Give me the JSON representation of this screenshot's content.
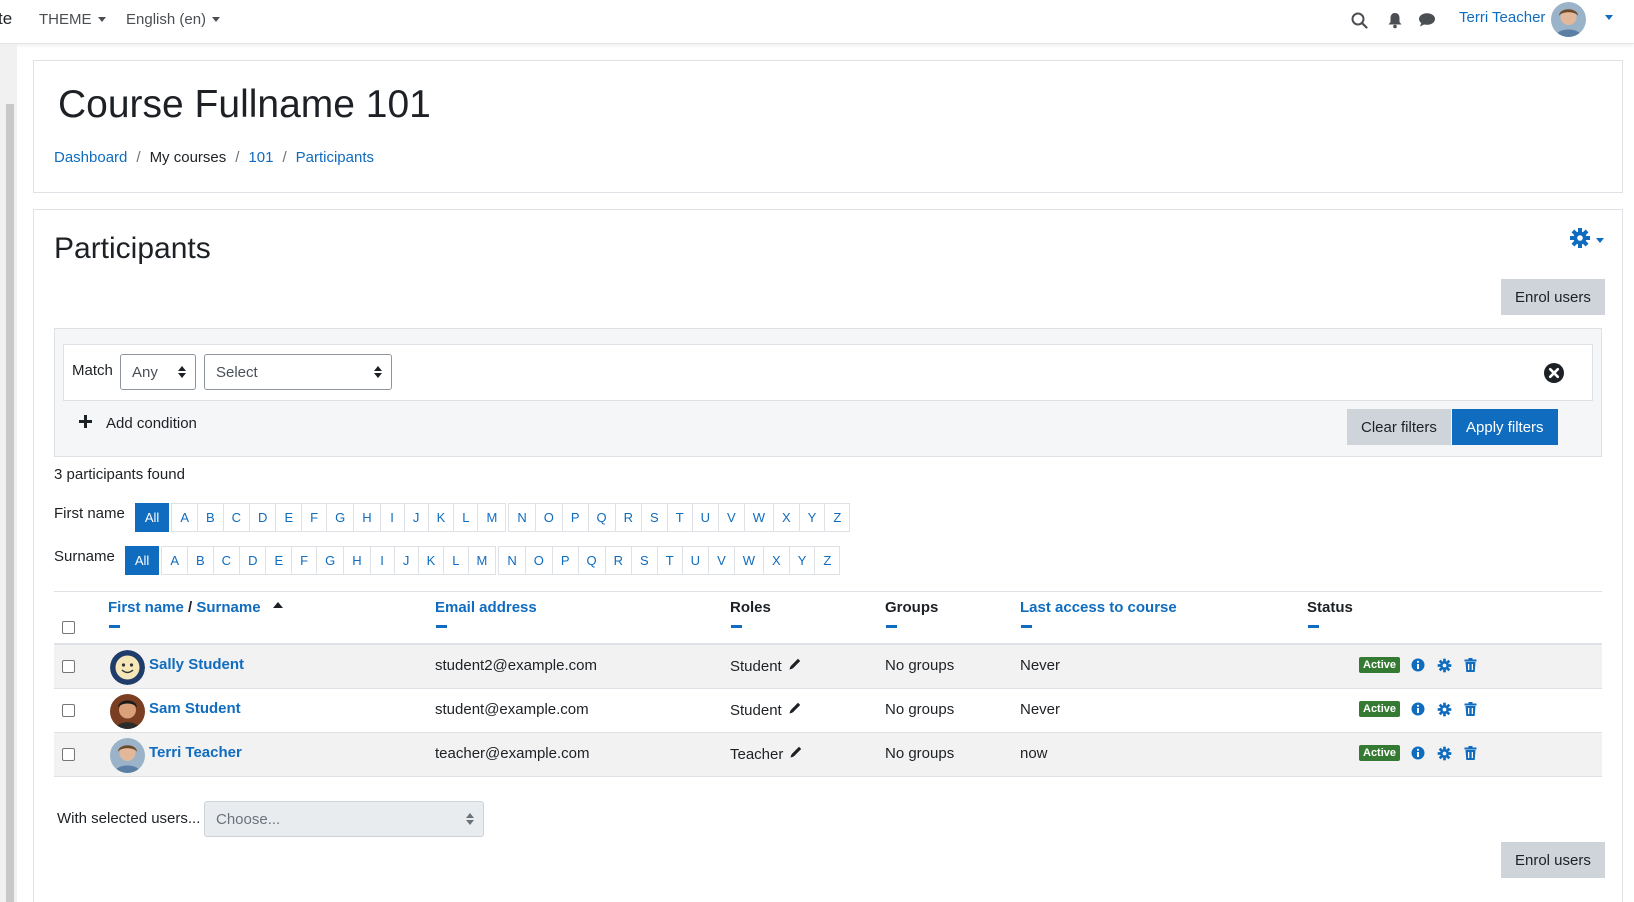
{
  "navbar": {
    "brand_fragment": "te",
    "theme_label": "THEME",
    "language_label": "English (en)",
    "user_name": "Terri Teacher"
  },
  "header": {
    "title": "Course Fullname 101",
    "breadcrumb": [
      "Dashboard",
      "My courses",
      "101",
      "Participants"
    ]
  },
  "participants": {
    "title": "Participants",
    "enrol_label": "Enrol users",
    "filter": {
      "match_label": "Match",
      "match_value": "Any",
      "select_value": "Select",
      "add_condition": "Add condition",
      "clear_label": "Clear filters",
      "apply_label": "Apply filters"
    },
    "found_text": "3 participants found",
    "firstname_label": "First name",
    "surname_label": "Surname",
    "initials_all": "All",
    "initials_1": [
      "A",
      "B",
      "C",
      "D",
      "E",
      "F",
      "G",
      "H",
      "I",
      "J",
      "K",
      "L",
      "M"
    ],
    "initials_2": [
      "N",
      "O",
      "P",
      "Q",
      "R",
      "S",
      "T",
      "U",
      "V",
      "W",
      "X",
      "Y",
      "Z"
    ],
    "columns": {
      "firstname": "First name",
      "slash": "/",
      "surname": "Surname",
      "email": "Email address",
      "roles": "Roles",
      "groups": "Groups",
      "lastaccess": "Last access to course",
      "status": "Status"
    },
    "rows": [
      {
        "name": "Sally Student",
        "email": "student2@example.com",
        "role": "Student",
        "groups": "No groups",
        "last_access": "Never",
        "status": "Active"
      },
      {
        "name": "Sam Student",
        "email": "student@example.com",
        "role": "Student",
        "groups": "No groups",
        "last_access": "Never",
        "status": "Active"
      },
      {
        "name": "Terri Teacher",
        "email": "teacher@example.com",
        "role": "Teacher",
        "groups": "No groups",
        "last_access": "now",
        "status": "Active"
      }
    ],
    "bulk_label": "With selected users...",
    "bulk_placeholder": "Choose..."
  },
  "colors": {
    "primary": "#0f6cbf",
    "secondary_btn": "#ced4da",
    "active_badge": "#357a32"
  }
}
